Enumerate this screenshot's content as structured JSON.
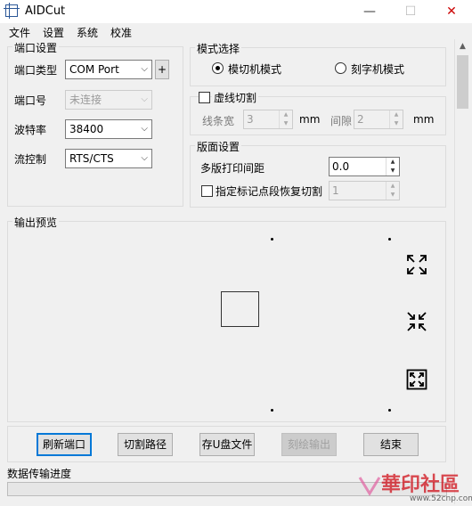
{
  "window": {
    "title": "AIDCut",
    "controls": [
      "—",
      "☐",
      "✕"
    ]
  },
  "menu": [
    "文件",
    "设置",
    "系统",
    "校准"
  ],
  "port": {
    "legend": "端口设置",
    "type_label": "端口类型",
    "type_value": "COM Port",
    "add_label": "+",
    "port_label": "端口号",
    "port_value": "未连接",
    "baud_label": "波特率",
    "baud_value": "38400",
    "flow_label": "流控制",
    "flow_value": "RTS/CTS"
  },
  "mode": {
    "legend": "模式选择",
    "die_cut_label": "模切机模式",
    "die_cut_selected": true,
    "engrave_label": "刻字机模式",
    "engrave_selected": false
  },
  "dashed": {
    "label": "虚线切割",
    "checked": false,
    "width_label": "线条宽",
    "width_value": "3",
    "width_unit": "mm",
    "gap_label": "间隙",
    "gap_value": "2",
    "gap_unit": "mm"
  },
  "layout": {
    "legend": "版面设置",
    "spacing_label": "多版打印间距",
    "spacing_value": "0.0",
    "marker_label": "指定标记点段恢复切割",
    "marker_checked": false,
    "marker_value": "1"
  },
  "preview": {
    "legend": "输出预览",
    "icons": [
      "expand-icon",
      "collapse-icon",
      "fit-icon"
    ]
  },
  "actions": {
    "refresh": "刷新端口",
    "cut_path": "切割路径",
    "save_usb": "存U盘文件",
    "engrave_out": "刻绘输出",
    "finish": "结束"
  },
  "status": {
    "progress_label": "数据传输进度",
    "progress": 0
  },
  "watermark": {
    "text": "華印社區",
    "url": "www.52cnp.com"
  }
}
